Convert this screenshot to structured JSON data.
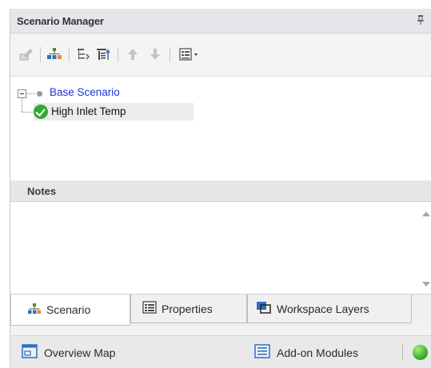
{
  "panel": {
    "title": "Scenario Manager",
    "pin_glyph": "↕"
  },
  "toolbar": {
    "buttons": [
      {
        "icon": "edit-scenario-icon",
        "enabled": false
      },
      {
        "icon": "add-child-scenario-icon",
        "enabled": true
      },
      {
        "icon": "expand-tree-icon",
        "enabled": true
      },
      {
        "icon": "collapse-tree-icon",
        "enabled": true
      },
      {
        "icon": "move-up-arrow-icon",
        "enabled": false
      },
      {
        "icon": "move-down-arrow-icon",
        "enabled": false
      },
      {
        "icon": "view-options-dropdown-icon",
        "enabled": true
      }
    ]
  },
  "tree": {
    "root_label": "Base Scenario",
    "child_label": "High Inlet Temp"
  },
  "notes": {
    "title": "Notes",
    "content": ""
  },
  "tabs": [
    {
      "label": "Scenario",
      "icon": "scenario-tree-icon",
      "active": true
    },
    {
      "label": "Properties",
      "icon": "properties-grid-icon",
      "active": false
    },
    {
      "label": "Workspace Layers",
      "icon": "workspace-layers-icon",
      "active": false
    }
  ],
  "statusbar": {
    "overview_label": "Overview Map",
    "addon_label": "Add-on Modules",
    "status_color": "#3db02a"
  },
  "colors": {
    "link_blue": "#1a35d8",
    "check_green": "#35a935",
    "titlebar_bg": "#e4e6ea"
  }
}
